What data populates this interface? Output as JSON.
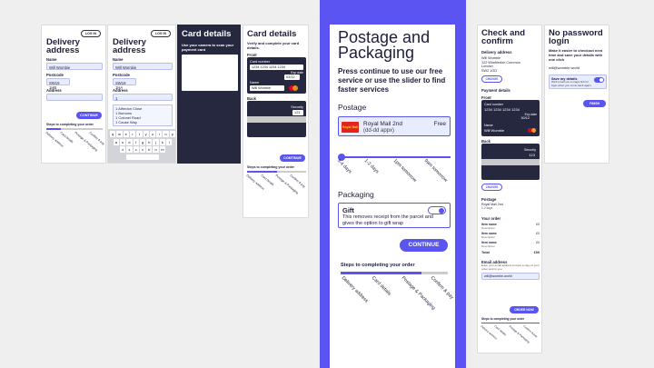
{
  "screens": {
    "s1": {
      "login": "LOG IN",
      "title": "Delivery address",
      "name_label": "Name",
      "name_value": "Will Wombie",
      "postcode_label": "Postcode",
      "postcode_value": "SW19 1HB",
      "address_label": "Address",
      "continue": "CONTINUE",
      "steps_title": "Steps to completing your order",
      "steps": [
        "Delivery address",
        "Card details",
        "Postage & Packaging",
        "Confirm & pay"
      ],
      "progress": 0.25
    },
    "s2": {
      "login": "LOG IN",
      "title": "Delivery address",
      "name_label": "Name",
      "name_value": "Will Wombie",
      "postcode_label": "Postcode",
      "postcode_value": "SW19 1HA",
      "address_label": "Address",
      "address_value": "1",
      "suggestions": [
        "1 Alfredon Close",
        "1 Burrows",
        "1 Colonel Road",
        "1 Cause Way"
      ],
      "keyboard": [
        [
          "q",
          "w",
          "e",
          "r",
          "t",
          "y",
          "u",
          "i",
          "o",
          "p"
        ],
        [
          "a",
          "s",
          "d",
          "f",
          "g",
          "h",
          "j",
          "k",
          "l"
        ],
        [
          "z",
          "x",
          "c",
          "v",
          "b",
          "n",
          "m"
        ]
      ]
    },
    "s3": {
      "title": "Card details",
      "instruction": "Use your camera to scan your payment card"
    },
    "s4": {
      "title": "Card details",
      "instruction": "Verify and complete your card details.",
      "front_label": "Front",
      "card_number_label": "Card number",
      "card_number": "1234 1234 1234 1234",
      "exp_label": "Exp date",
      "exp_value": "03/12",
      "name_label": "Name",
      "name_value": "Will Wombie",
      "back_label": "Back",
      "security_label": "Security",
      "security_value": "123",
      "continue": "CONTINUE",
      "steps_title": "Steps to completing your order",
      "steps": [
        "Delivery address",
        "Card details",
        "Postage & Packaging",
        "Confirm & pay"
      ],
      "progress": 0.5
    },
    "s5": {
      "title": "Postage and Packaging",
      "subtitle": "Press continue to use our free service or use the slider to find faster services",
      "postage_label": "Postage",
      "carrier_logo": "Royal Mail",
      "carrier_name": "Royal Mail 2nd",
      "carrier_price": "Free",
      "carrier_eta": "(dd-dd appx)",
      "slider_ticks": [
        "3-4 days",
        "1-2 days",
        "1pm tomorrow",
        "9am tomorrow"
      ],
      "slider_value": 0,
      "packaging_label": "Packaging",
      "gift_title": "Gift",
      "gift_text": "This removes receipt from the parcel and gives the option to gift wrap",
      "continue": "CONTINUE",
      "steps_title": "Steps to completing your order",
      "steps": [
        "Delivery address",
        "Card details",
        "Postage & Packaging",
        "Confirm & pay"
      ],
      "progress": 0.75
    },
    "s6": {
      "title": "Check and confirm",
      "delivery_label": "Delivery address",
      "address_lines": [
        "Will Wombie",
        "122 Wimbledon Common",
        "London",
        "SW2 1GD"
      ],
      "change": "CHANGE",
      "payment_label": "Payment details",
      "front_label": "Front",
      "card_number_label": "Card number",
      "card_number": "1234 1234 1234 1234",
      "exp_label": "Exp date",
      "exp_value": "30/12",
      "name_label": "Name",
      "name_value": "Will Wombie",
      "back_label": "Back",
      "security_label": "Security",
      "security_value": "123",
      "change2": "CHANGE",
      "postage_label": "Postage",
      "postage_value": "Royal Mail 2nd",
      "postage_sub": "1-2 days",
      "order_label": "Your order",
      "items": [
        {
          "name": "Item name",
          "desc": "Description",
          "price": "£0"
        },
        {
          "name": "Item name",
          "desc": "Description",
          "price": "£0"
        },
        {
          "name": "Item name",
          "desc": "Description",
          "price": "£0"
        }
      ],
      "total_label": "Total",
      "total_value": "£00",
      "email_label": "Email address",
      "email_help": "Enter your email address to have a copy of your order sent to you",
      "email_value": "will@wombie.world",
      "order_now": "ORDER NOW",
      "steps_title": "Steps to completing your order",
      "steps": [
        "Delivery address",
        "Card details",
        "Postage & Packaging",
        "Confirm & pay"
      ],
      "progress": 1.0
    },
    "s7": {
      "title": "No password login",
      "text": "Make it easier to checkout next time and save your details with one click",
      "email": "will@wombie.world",
      "save_title": "Save my details",
      "save_text": "We'll email you a magic link for login when you come back again",
      "save_on": true,
      "finish": "FINISH"
    }
  },
  "colors": {
    "accent": "#5a55f0",
    "dark": "#262840",
    "input_bg": "#e8ecff"
  }
}
